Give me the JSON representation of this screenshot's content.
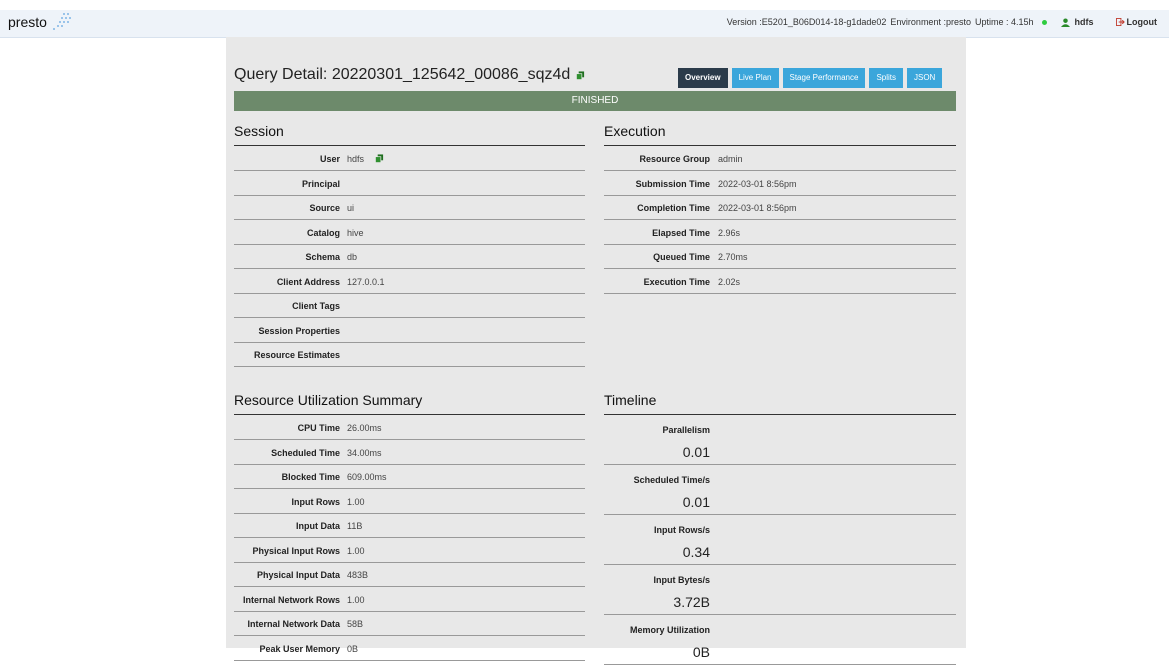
{
  "header": {
    "logo_text": "presto",
    "version_label": "Version :E5201_B06D014-18-g1dade02",
    "environment_label": "Environment :presto",
    "uptime_label": "Uptime : 4.15h",
    "user": "hdfs",
    "logout_label": "Logout"
  },
  "query": {
    "title": "Query Detail: 20220301_125642_00086_sqz4d",
    "status": "FINISHED"
  },
  "tabs": [
    {
      "label": "Overview",
      "active": true
    },
    {
      "label": "Live Plan",
      "active": false
    },
    {
      "label": "Stage Performance",
      "active": false
    },
    {
      "label": "Splits",
      "active": false
    },
    {
      "label": "JSON",
      "active": false
    }
  ],
  "session": {
    "title": "Session",
    "rows": [
      {
        "key": "User",
        "value": "hdfs"
      },
      {
        "key": "Principal",
        "value": ""
      },
      {
        "key": "Source",
        "value": "ui"
      },
      {
        "key": "Catalog",
        "value": "hive"
      },
      {
        "key": "Schema",
        "value": "db"
      },
      {
        "key": "Client Address",
        "value": "127.0.0.1"
      },
      {
        "key": "Client Tags",
        "value": ""
      },
      {
        "key": "Session Properties",
        "value": ""
      },
      {
        "key": "Resource Estimates",
        "value": ""
      }
    ]
  },
  "execution": {
    "title": "Execution",
    "rows": [
      {
        "key": "Resource Group",
        "value": "admin"
      },
      {
        "key": "Submission Time",
        "value": "2022-03-01 8:56pm"
      },
      {
        "key": "Completion Time",
        "value": "2022-03-01 8:56pm"
      },
      {
        "key": "Elapsed Time",
        "value": "2.96s"
      },
      {
        "key": "Queued Time",
        "value": "2.70ms"
      },
      {
        "key": "Execution Time",
        "value": "2.02s"
      }
    ]
  },
  "resource_summary": {
    "title": "Resource Utilization Summary",
    "rows": [
      {
        "key": "CPU Time",
        "value": "26.00ms"
      },
      {
        "key": "Scheduled Time",
        "value": "34.00ms"
      },
      {
        "key": "Blocked Time",
        "value": "609.00ms"
      },
      {
        "key": "Input Rows",
        "value": "1.00"
      },
      {
        "key": "Input Data",
        "value": "11B"
      },
      {
        "key": "Physical Input Rows",
        "value": "1.00"
      },
      {
        "key": "Physical Input Data",
        "value": "483B"
      },
      {
        "key": "Internal Network Rows",
        "value": "1.00"
      },
      {
        "key": "Internal Network Data",
        "value": "58B"
      },
      {
        "key": "Peak User Memory",
        "value": "0B"
      }
    ]
  },
  "timeline": {
    "title": "Timeline",
    "rows": [
      {
        "label": "Parallelism",
        "value": "0.01"
      },
      {
        "label": "Scheduled Time/s",
        "value": "0.01"
      },
      {
        "label": "Input Rows/s",
        "value": "0.34"
      },
      {
        "label": "Input Bytes/s",
        "value": "3.72B"
      },
      {
        "label": "Memory Utilization",
        "value": "0B"
      }
    ]
  }
}
